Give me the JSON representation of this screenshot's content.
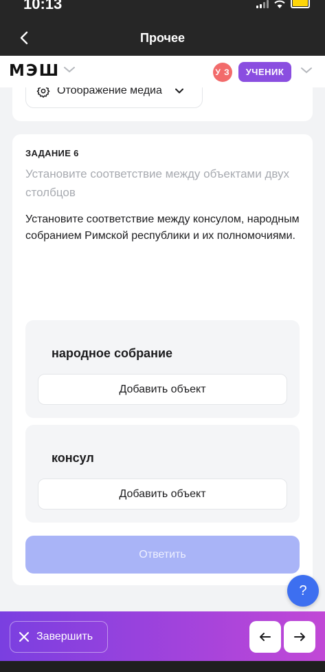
{
  "status_bar": {
    "time": "10:13"
  },
  "nav": {
    "title": "Прочее"
  },
  "header": {
    "logo": "МЭШ",
    "avatar_initials": "У З",
    "role": "УЧЕНИК"
  },
  "media": {
    "label": "Отображение медиа"
  },
  "task": {
    "title": "ЗАДАНИЕ 6",
    "hint": "Установите соответствие между объектами двух столбцов",
    "text": "Установите соответствие между консулом, народным собранием Римской республики и их полномочиями.",
    "groups": [
      {
        "label": "народное собрание",
        "add_label": "Добавить объект"
      },
      {
        "label": "консул",
        "add_label": "Добавить объект"
      }
    ],
    "answer_label": "Ответить"
  },
  "help": {
    "label": "?"
  },
  "bottom": {
    "finish_label": "Завершить"
  },
  "colors": {
    "accent": "#3d6ff0",
    "role_badge": "#8a4ee0",
    "avatar": "#f26b6b",
    "answer_disabled": "#a9b4f7"
  }
}
